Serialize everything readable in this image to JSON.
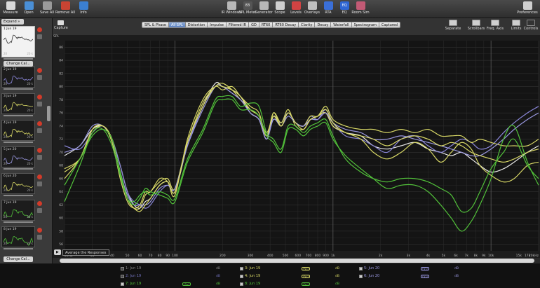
{
  "toolbar": {
    "left": [
      {
        "label": "Measure",
        "icon": "microphone-icon",
        "color": "#d9d9d9"
      },
      {
        "label": "Open",
        "icon": "folder-icon",
        "color": "#4a8fd6"
      },
      {
        "label": "Save All",
        "icon": "save-icon",
        "color": "#9a9a9a"
      },
      {
        "label": "Remove All",
        "icon": "remove-icon",
        "color": "#c94433"
      },
      {
        "label": "Info",
        "icon": "info-icon",
        "color": "#3b7fd1"
      }
    ],
    "center": [
      {
        "label": "IR Windows",
        "icon": "ir-windows-icon",
        "color": "#b8b8b8"
      },
      {
        "label": "SPL Meter",
        "icon": "spl-meter-icon",
        "color": "#555555",
        "text": "83"
      },
      {
        "label": "Generator",
        "icon": "generator-icon",
        "color": "#b8b8b8"
      },
      {
        "label": "Scope",
        "icon": "scope-icon",
        "color": "#cfcfcf"
      },
      {
        "label": "Levels",
        "icon": "levels-icon",
        "color": "#d24343"
      },
      {
        "label": "Overlays",
        "icon": "overlays-icon",
        "color": "#bfbfbf"
      },
      {
        "label": "RTA",
        "icon": "rta-icon",
        "color": "#3a6fd8"
      },
      {
        "label": "EQ",
        "icon": "eq-icon",
        "color": "#2f66d4",
        "text": "EQ"
      },
      {
        "label": "Room Sim",
        "icon": "room-sim-icon",
        "color": "#c25a75"
      }
    ],
    "right": [
      {
        "label": "Preferences",
        "icon": "preferences-icon",
        "color": "#cfcfcf"
      }
    ]
  },
  "sidebar": {
    "expand_label": "Expand",
    "expand_arrow": "»",
    "change_cal_label": "Change Cal...",
    "measurements": [
      {
        "name": "1 Jun 19",
        "left": "20",
        "right": "20 k",
        "color": "#e8e8e8",
        "selected": true
      },
      {
        "name": "2 Jun 19",
        "left": "20",
        "right": "20 k",
        "color": "#8a86d8",
        "selected": false
      },
      {
        "name": "3 Jun 19",
        "left": "20",
        "right": "20 k",
        "color": "#d8d866",
        "selected": false
      },
      {
        "name": "4 Jun 19",
        "left": "20",
        "right": "20 k",
        "color": "#d8d866",
        "selected": false
      },
      {
        "name": "5 Jun 20",
        "left": "20",
        "right": "20 k",
        "color": "#9a98e0",
        "selected": false
      },
      {
        "name": "6 Jun 20",
        "left": "20",
        "right": "20 k",
        "color": "#d8d866",
        "selected": false
      },
      {
        "name": "7 Jun 19",
        "left": "20",
        "right": "20 k",
        "color": "#52c23a",
        "selected": false
      },
      {
        "name": "8 Jun 19",
        "left": "20",
        "right": "20 k",
        "color": "#52c23a",
        "selected": false
      }
    ]
  },
  "row2": {
    "capture_label": "Capture",
    "tabs": [
      "SPL & Phase",
      "All SPL",
      "Distortion",
      "Impulse",
      "Filtered IR",
      "GD",
      "RT60",
      "RT60 Decay",
      "Clarity",
      "Decay",
      "Waterfall",
      "Spectrogram",
      "Captured"
    ],
    "active_tab": "All SPL",
    "right_tools": [
      {
        "label": "Separate",
        "icon": "separate-icon"
      },
      {
        "label": "Scrollbars",
        "icon": "scrollbars-icon"
      },
      {
        "label": "Freq. Axis",
        "icon": "freq-axis-icon"
      },
      {
        "label": "Limits",
        "icon": "limits-icon"
      },
      {
        "label": "Controls",
        "icon": "controls-icon"
      }
    ]
  },
  "graph": {
    "y_unit": "SPL",
    "x_unit": "20kHz",
    "average_button": "▶",
    "average_label": "Average the Responses",
    "y_ticks": [
      86,
      84,
      82,
      80,
      78,
      76,
      74,
      72,
      70,
      68,
      66,
      64,
      62,
      60,
      58,
      56
    ],
    "x_ticks": [
      "20Hz",
      "30",
      "40",
      "50",
      "60",
      "70",
      "80",
      "90",
      "100",
      "200",
      "300",
      "400",
      "500",
      "600",
      "700",
      "800",
      "900",
      "1k",
      "2k",
      "3k",
      "4k",
      "5k",
      "6k",
      "7k",
      "8k",
      "9k",
      "10k",
      "15k",
      "17k",
      "20kHz"
    ]
  },
  "chart_data": {
    "type": "line",
    "xlabel": "",
    "ylabel": "SPL",
    "xscale": "log",
    "xlim": [
      20,
      20000
    ],
    "ylim": [
      55,
      87
    ],
    "grid": true,
    "x": [
      20,
      25,
      30,
      35,
      40,
      45,
      50,
      55,
      60,
      65,
      70,
      80,
      90,
      100,
      120,
      150,
      180,
      200,
      230,
      260,
      300,
      340,
      380,
      420,
      470,
      520,
      580,
      650,
      720,
      800,
      900,
      1000,
      1200,
      1500,
      1800,
      2200,
      2700,
      3300,
      4000,
      4800,
      5600,
      6500,
      7500,
      8500,
      10000,
      12000,
      14000,
      17000,
      20000
    ],
    "series": [
      {
        "name": "1 Jun 19",
        "color": "#e8e8e8",
        "values": [
          69.5,
          71,
          73.5,
          74,
          72,
          68,
          64,
          62,
          61.5,
          62.5,
          63,
          65,
          65.5,
          64,
          71,
          77,
          80.5,
          80,
          79.5,
          78.5,
          76,
          75,
          72,
          75.5,
          74,
          76,
          74.5,
          74,
          75,
          75.5,
          76,
          74,
          73,
          72.5,
          71,
          70.5,
          71,
          71.5,
          70.5,
          70,
          69.5,
          70,
          69,
          68,
          67,
          67.5,
          68.5,
          70,
          71
        ]
      },
      {
        "name": "2 Jun 19",
        "color": "#8a86d8",
        "values": [
          71,
          70.5,
          73,
          74,
          72,
          68,
          64,
          62.5,
          62,
          61.5,
          62,
          64,
          65,
          64.5,
          71,
          77,
          80,
          80,
          79,
          78,
          76.5,
          75.5,
          72.5,
          75,
          74.5,
          76,
          74.5,
          74,
          75.5,
          75,
          76.5,
          74.5,
          72.5,
          72,
          71,
          70,
          72,
          72.5,
          71,
          70,
          71,
          72,
          71.5,
          70.5,
          71,
          73,
          74.5,
          76,
          77
        ]
      },
      {
        "name": "3 Jun 19",
        "color": "#d8d866",
        "values": [
          67.5,
          69,
          73,
          74,
          72,
          67,
          63,
          61.5,
          61.5,
          63.5,
          64,
          65.5,
          66,
          64.5,
          71.5,
          77.5,
          80,
          80.5,
          79.5,
          78,
          76.5,
          75.5,
          72.5,
          76,
          74,
          76,
          74.5,
          74,
          75.5,
          75.5,
          77,
          75,
          74,
          73.5,
          73.5,
          73,
          73.5,
          73,
          73.5,
          72.5,
          72.5,
          72.5,
          71.5,
          72,
          71.5,
          71,
          71,
          71,
          72
        ]
      },
      {
        "name": "4 Jun 19",
        "color": "#d8d866",
        "values": [
          66,
          69,
          73.5,
          74,
          71.5,
          66,
          62.5,
          61.5,
          62,
          64,
          64,
          66,
          65.5,
          63.5,
          72,
          78,
          80,
          79.5,
          80,
          78.5,
          77,
          76,
          72.5,
          76,
          74.5,
          76.5,
          74,
          73.5,
          75,
          75.5,
          76,
          74,
          73,
          72,
          70,
          69,
          70,
          71.5,
          70.5,
          68.5,
          70,
          71.5,
          70.5,
          68,
          66.5,
          65.5,
          66,
          68,
          68.5
        ]
      },
      {
        "name": "5 Jun 20",
        "color": "#9a98e0",
        "values": [
          70,
          71,
          74,
          74,
          72,
          67,
          63.5,
          62,
          62,
          62,
          62.5,
          64.5,
          65,
          64.5,
          71,
          76.5,
          80,
          80,
          79,
          78,
          76,
          75,
          72,
          75,
          74,
          75.5,
          74.5,
          74,
          75,
          75,
          76,
          74.5,
          73.5,
          73,
          72,
          72,
          72.5,
          72,
          71.5,
          71,
          70.5,
          70,
          69.5,
          69.5,
          70.5,
          72,
          73.5,
          75,
          76
        ]
      },
      {
        "name": "6 Jun 20",
        "color": "#d8d866",
        "values": [
          67,
          69,
          73.5,
          74,
          72,
          67,
          63,
          61.5,
          61,
          62,
          63,
          65,
          65.5,
          64,
          71.5,
          77,
          80,
          80,
          79.5,
          78.5,
          76.5,
          75.5,
          73,
          75.5,
          74,
          76,
          74.5,
          73.5,
          75,
          75.5,
          76.5,
          74.5,
          73,
          72.5,
          72,
          71,
          72,
          72.5,
          72,
          71,
          71.5,
          71,
          70,
          69.5,
          69,
          68.5,
          69,
          70,
          70.5
        ]
      },
      {
        "name": "7 Jun 19",
        "color": "#52c23a",
        "values": [
          62.5,
          68,
          73,
          73.5,
          71,
          66.5,
          63,
          62.5,
          63.5,
          64,
          63.5,
          64,
          63.5,
          63,
          69,
          73.5,
          78,
          78.5,
          78.5,
          77,
          77.5,
          77,
          73,
          72,
          70.5,
          74,
          74,
          73,
          74,
          74.5,
          75,
          72.5,
          69,
          67,
          66,
          65.5,
          66,
          66,
          65.5,
          64.5,
          63.5,
          61,
          61.5,
          64,
          67.5,
          70,
          72,
          68,
          66
        ]
      },
      {
        "name": "8 Jun 19",
        "color": "#52c23a",
        "values": [
          65,
          69,
          72.5,
          73.5,
          72,
          67,
          63,
          62,
          63,
          64.5,
          64,
          63.5,
          63,
          62.5,
          68.5,
          73,
          77.5,
          78,
          78,
          76.5,
          76.5,
          75.5,
          72.5,
          71.5,
          70,
          73.5,
          73.5,
          72.5,
          73.5,
          74,
          74.5,
          72,
          69.5,
          67.5,
          66,
          64.5,
          65,
          65,
          64,
          62,
          60,
          58,
          59.5,
          62,
          66,
          72,
          74,
          68.5,
          65
        ]
      }
    ]
  },
  "legend": {
    "items": [
      {
        "label": "1: Jun 19",
        "checked": false,
        "color": "#8a8a8a",
        "db": "dB",
        "swatch": ""
      },
      {
        "label": "2: Jun 19",
        "checked": false,
        "color": "#7474c0",
        "db": "dB",
        "swatch": ""
      },
      {
        "label": "3: Jun 19",
        "checked": true,
        "color": "#d8d866",
        "db": "dB",
        "swatch": "(V₁)"
      },
      {
        "label": "4: Jun 19",
        "checked": true,
        "color": "#d8d866",
        "db": "dB",
        "swatch": "(V₁)"
      },
      {
        "label": "5: Jun 20",
        "checked": true,
        "color": "#9a98e0",
        "db": "dB",
        "swatch": "(V₁)"
      },
      {
        "label": "6: Jun 20",
        "checked": true,
        "color": "#9a98e0",
        "db": "dB",
        "swatch": "(V₁)"
      },
      {
        "label": "7: Jun 19",
        "checked": true,
        "color": "#52c23a",
        "db": "dB",
        "swatch": "(V₁)"
      },
      {
        "label": "8: Jun 19",
        "checked": true,
        "color": "#52c23a",
        "db": "dB",
        "swatch": "(V₁)"
      }
    ]
  }
}
